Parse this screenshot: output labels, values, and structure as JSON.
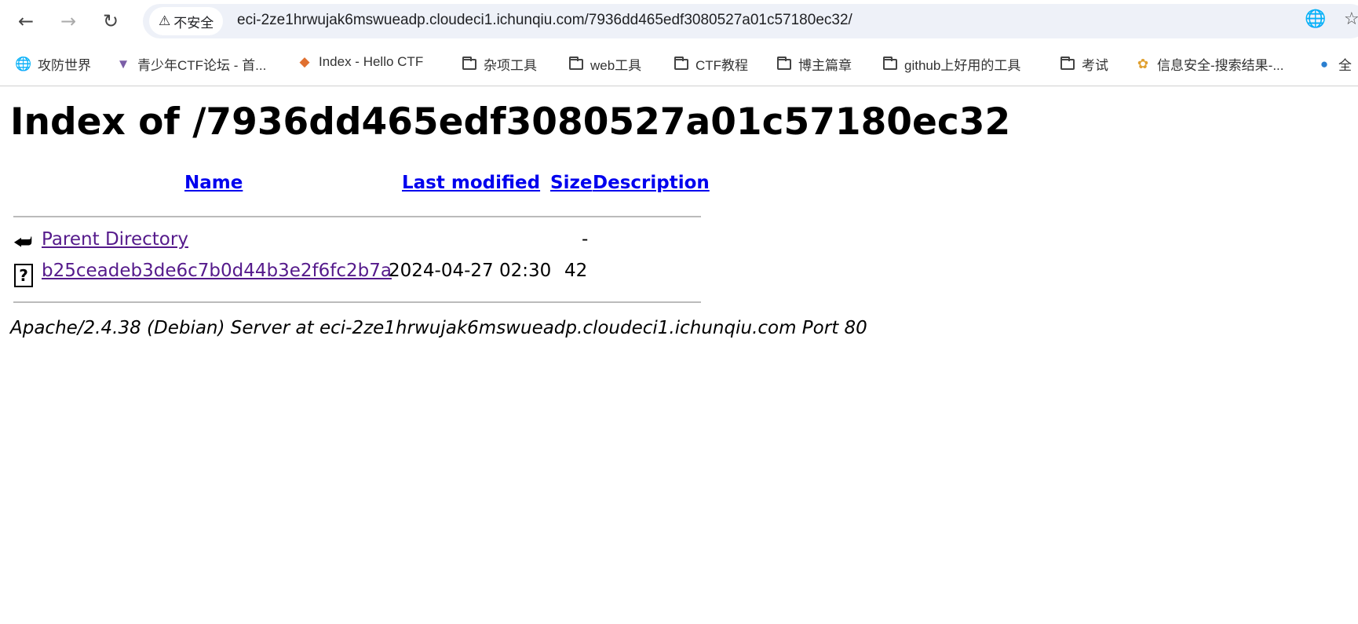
{
  "browser": {
    "security_label": "不安全",
    "url": "eci-2ze1hrwujak6mswueadp.cloudeci1.ichunqiu.com/7936dd465edf3080527a01c57180ec32/",
    "bookmarks": [
      {
        "label": "攻防世界",
        "icon": "globe-icon"
      },
      {
        "label": "青少年CTF论坛 - 首...",
        "icon": "site-icon"
      },
      {
        "label": "Index - Hello CTF",
        "icon": "site-icon"
      },
      {
        "label": "杂项工具",
        "icon": "folder-icon"
      },
      {
        "label": "web工具",
        "icon": "folder-icon"
      },
      {
        "label": "CTF教程",
        "icon": "folder-icon"
      },
      {
        "label": "博主篇章",
        "icon": "folder-icon"
      },
      {
        "label": "github上好用的工具",
        "icon": "folder-icon"
      },
      {
        "label": "考试",
        "icon": "folder-icon"
      },
      {
        "label": "信息安全-搜索结果-...",
        "icon": "site-icon"
      },
      {
        "label": "全",
        "icon": "site-icon"
      }
    ]
  },
  "page": {
    "title": "Index of /7936dd465edf3080527a01c57180ec32",
    "columns": [
      "Name",
      "Last modified",
      "Size",
      "Description"
    ],
    "rows": [
      {
        "name": "Parent Directory",
        "modified": "",
        "size": "-",
        "description": "",
        "icon": "back-arrow-icon"
      },
      {
        "name": "b25ceadeb3de6c7b0d44b3e2f6fc2b7a",
        "modified": "2024-04-27 02:30",
        "size": "42",
        "description": "",
        "icon": "unknown-file-icon"
      }
    ],
    "address": "Apache/2.4.38 (Debian) Server at eci-2ze1hrwujak6mswueadp.cloudeci1.ichunqiu.com Port 80"
  }
}
